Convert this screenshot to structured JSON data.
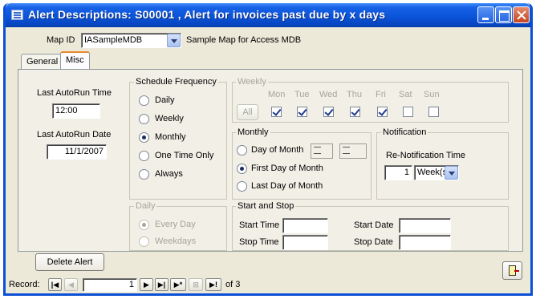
{
  "window": {
    "title": "Alert Descriptions: S00001 , Alert for invoices past due by x days"
  },
  "header": {
    "map_id_label": "Map ID",
    "map_id_value": "IASampleMDB",
    "map_description": "Sample Map for Access MDB"
  },
  "tabs": [
    {
      "label": "General",
      "active": false
    },
    {
      "label": "Misc",
      "active": true
    }
  ],
  "misc": {
    "last_autorun_time_label": "Last AutoRun Time",
    "last_autorun_time_value": "12:00",
    "last_autorun_date_label": "Last AutoRun Date",
    "last_autorun_date_value": "11/1/2007",
    "delete_alert_label": "Delete Alert",
    "schedule_frequency": {
      "label": "Schedule Frequency",
      "options": [
        "Daily",
        "Weekly",
        "Monthly",
        "One Time Only",
        "Always"
      ],
      "selected": "Monthly"
    },
    "weekly": {
      "label": "Weekly",
      "all_label": "All",
      "days": [
        {
          "label": "Mon",
          "checked": true
        },
        {
          "label": "Tue",
          "checked": true
        },
        {
          "label": "Wed",
          "checked": true
        },
        {
          "label": "Thu",
          "checked": true
        },
        {
          "label": "Fri",
          "checked": true
        },
        {
          "label": "Sat",
          "checked": false
        },
        {
          "label": "Sun",
          "checked": false
        }
      ]
    },
    "monthly": {
      "label": "Monthly",
      "options": [
        "Day of Month",
        "First Day of Month",
        "Last Day of Month"
      ],
      "selected": "First Day of Month"
    },
    "notification": {
      "label": "Notification",
      "renotification_label": "Re-Notification Time",
      "value": "1",
      "unit": "Week(s)"
    },
    "daily": {
      "label": "Daily",
      "options": [
        "Every Day",
        "Weekdays"
      ],
      "selected": "Every Day"
    },
    "start_stop": {
      "label": "Start and Stop",
      "start_time_label": "Start Time",
      "stop_time_label": "Stop Time",
      "start_date_label": "Start Date",
      "stop_date_label": "Stop Date",
      "start_time": "",
      "stop_time": "",
      "start_date": "",
      "stop_date": ""
    }
  },
  "record_nav": {
    "label": "Record:",
    "current": "1",
    "of_label": "of 3"
  }
}
